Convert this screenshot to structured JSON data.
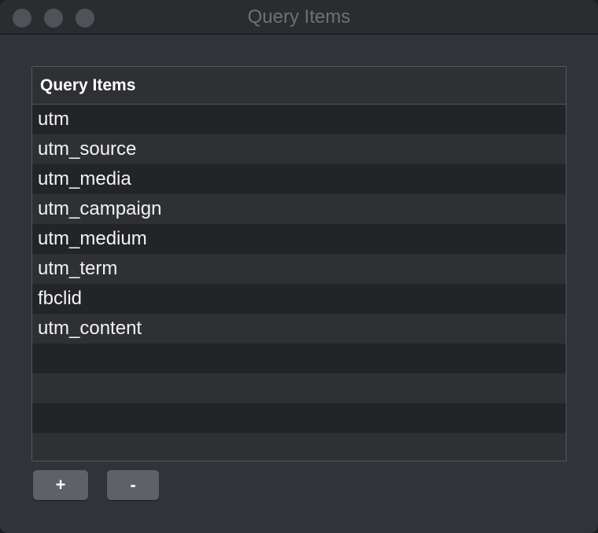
{
  "window": {
    "title": "Query Items"
  },
  "table": {
    "column_header": "Query Items",
    "rows": [
      "utm",
      "utm_source",
      "utm_media",
      "utm_campaign",
      "utm_medium",
      "utm_term",
      "fbclid",
      "utm_content",
      "",
      "",
      "",
      ""
    ]
  },
  "buttons": {
    "add_label": "+",
    "remove_label": "-"
  },
  "colors": {
    "window_background": "#313338",
    "titlebar_background": "#2b2c30",
    "title_text": "#6e7077",
    "row_dark": "#222428",
    "row_light": "#2e3034",
    "button_background": "#5f6166"
  }
}
